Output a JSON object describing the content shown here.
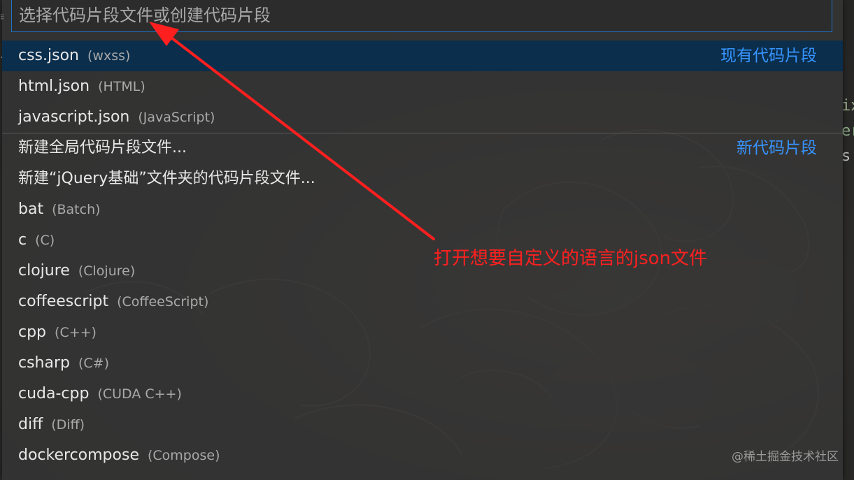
{
  "search": {
    "placeholder": "选择代码片段文件或创建代码片段"
  },
  "items": [
    {
      "label": "css.json",
      "description": "(wxss)",
      "group": "现有代码片段",
      "selected": true
    },
    {
      "label": "html.json",
      "description": "(HTML)"
    },
    {
      "label": "javascript.json",
      "description": "(JavaScript)"
    },
    {
      "label": "新建全局代码片段文件...",
      "description": "",
      "group": "新代码片段",
      "separator": true
    },
    {
      "label": "新建“jQuery基础”文件夹的代码片段文件...",
      "description": ""
    },
    {
      "label": "bat",
      "description": "(Batch)"
    },
    {
      "label": "c",
      "description": "(C)"
    },
    {
      "label": "clojure",
      "description": "(Clojure)"
    },
    {
      "label": "coffeescript",
      "description": "(CoffeeScript)"
    },
    {
      "label": "cpp",
      "description": "(C++)"
    },
    {
      "label": "csharp",
      "description": "(C#)"
    },
    {
      "label": "cuda-cpp",
      "description": "(CUDA C++)"
    },
    {
      "label": "diff",
      "description": "(Diff)"
    },
    {
      "label": "dockercompose",
      "description": "(Compose)"
    }
  ],
  "annotation": {
    "text": "打开想要自定义的语言的json文件",
    "color": "#ff2020"
  },
  "editor_fragments": [
    "ix",
    "er",
    "s"
  ],
  "watermark": "@稀土掘金技术社区",
  "colors": {
    "accent": "#3794ff",
    "focus_border": "#1f73c8",
    "selection": "#062e4e"
  }
}
